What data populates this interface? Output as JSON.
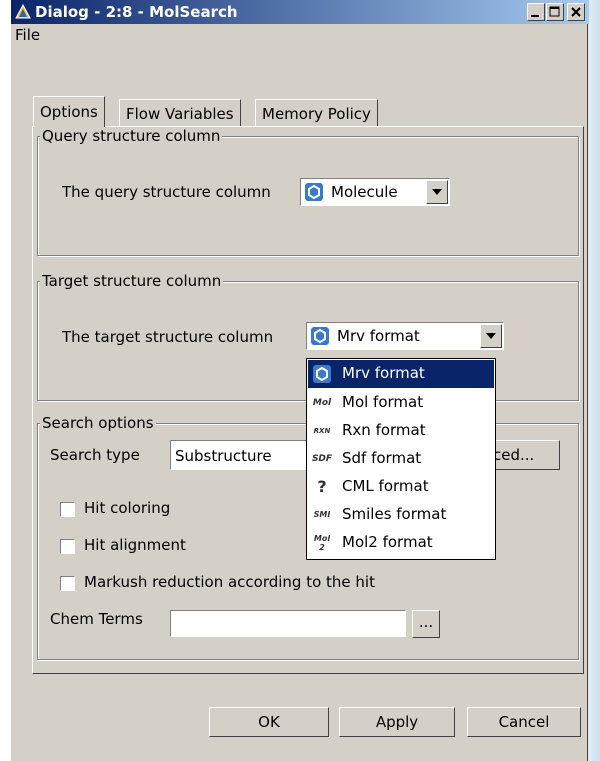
{
  "window": {
    "title": "Dialog - 2:8 - MolSearch",
    "controls": [
      "minimize",
      "maximize",
      "close"
    ]
  },
  "menu": {
    "file": "File"
  },
  "tabs": [
    {
      "label": "Options",
      "active": true
    },
    {
      "label": "Flow Variables",
      "active": false
    },
    {
      "label": "Memory Policy",
      "active": false
    }
  ],
  "query_group": {
    "title": "Query structure column",
    "label": "The query structure column",
    "selected": "Molecule"
  },
  "target_group": {
    "title": "Target structure column",
    "label": "The target structure column",
    "selected": "Mrv format"
  },
  "dropdown": {
    "items": [
      {
        "label": "Mrv format",
        "icon": "molecule-ring-icon",
        "selected": true
      },
      {
        "label": "Mol format",
        "icon": "mol-icon",
        "badge": "Mol"
      },
      {
        "label": "Rxn format",
        "icon": "rxn-icon",
        "badge": "RXN"
      },
      {
        "label": "Sdf format",
        "icon": "sdf-icon",
        "badge": "SDF"
      },
      {
        "label": "CML format",
        "icon": "question-icon",
        "badge": "?"
      },
      {
        "label": "Smiles format",
        "icon": "smi-icon",
        "badge": "SMI"
      },
      {
        "label": "Mol2 format",
        "icon": "mol2-icon",
        "badge": "Mol 2"
      }
    ]
  },
  "search_group": {
    "title": "Search options",
    "search_type_label": "Search type",
    "search_type_value": "Substructure",
    "advanced_partial": "ced...",
    "hit_coloring": "Hit coloring",
    "hit_alignment": "Hit alignment",
    "markush": "Markush reduction according to the hit",
    "chem_terms_label": "Chem Terms",
    "chem_terms_value": "",
    "browse": "..."
  },
  "buttons": {
    "ok": "OK",
    "apply": "Apply",
    "cancel": "Cancel"
  },
  "colors": {
    "dialog_bg": "#d4d0c8",
    "title_start": "#0a246a",
    "title_end": "#a6caf0",
    "selection": "#0a246a"
  }
}
